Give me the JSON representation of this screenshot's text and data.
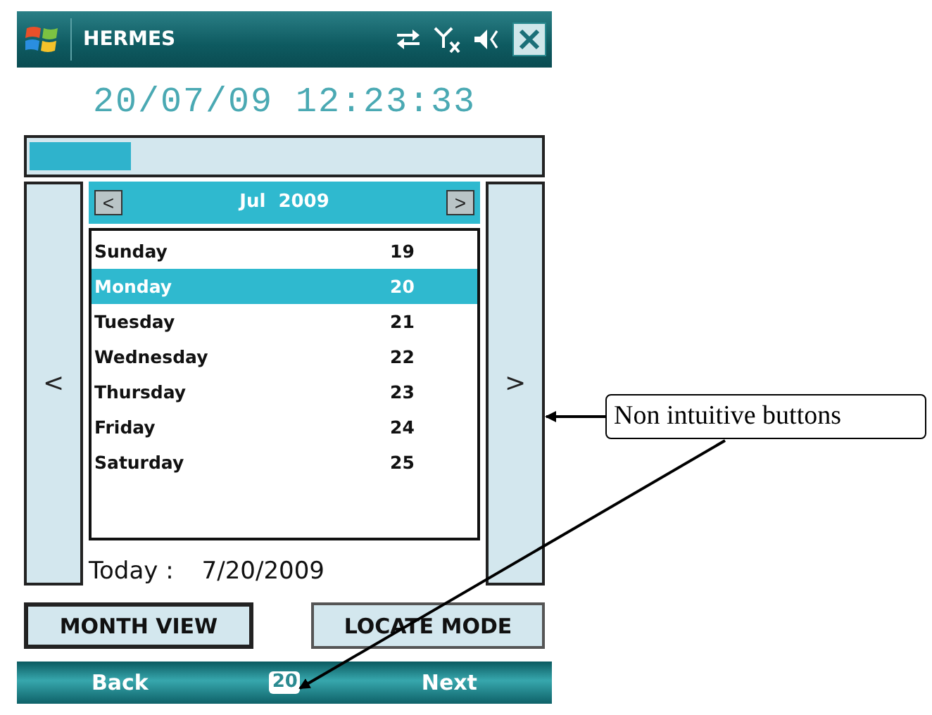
{
  "title_bar": {
    "title": "HERMES"
  },
  "clock": "20/07/09 12:23:33",
  "progress": {
    "level": 0.2
  },
  "nav": {
    "prev": "<",
    "next": ">"
  },
  "calendar": {
    "month": "Jul  2009",
    "prev": "<",
    "next": ">",
    "days": [
      {
        "day": "Sunday",
        "date": "19",
        "selected": false
      },
      {
        "day": "Monday",
        "date": "20",
        "selected": true
      },
      {
        "day": "Tuesday",
        "date": "21",
        "selected": false
      },
      {
        "day": "Wednesday",
        "date": "22",
        "selected": false
      },
      {
        "day": "Thursday",
        "date": "23",
        "selected": false
      },
      {
        "day": "Friday",
        "date": "24",
        "selected": false
      },
      {
        "day": "Saturday",
        "date": "25",
        "selected": false
      }
    ]
  },
  "today": {
    "label": "Today :",
    "value": "7/20/2009"
  },
  "buttons": [
    "MONTH VIEW",
    "LOCATE MODE"
  ],
  "softkeys": {
    "left": "Back",
    "center": "20",
    "right": "Next"
  },
  "annotation": {
    "text": "Non intuitive buttons"
  }
}
